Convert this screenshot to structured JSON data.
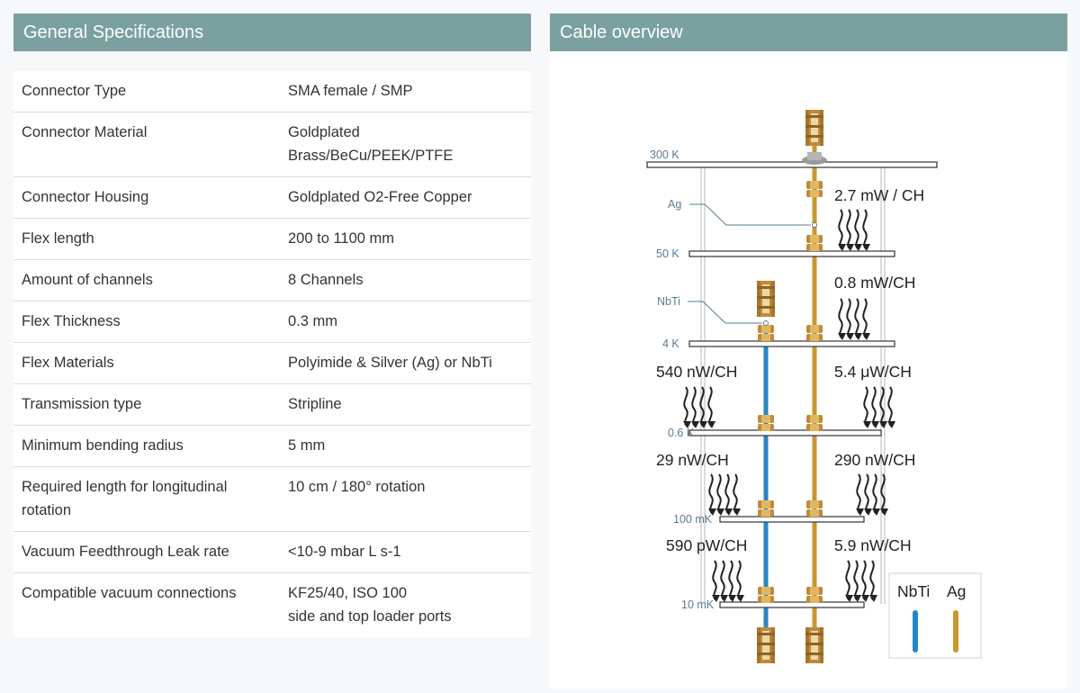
{
  "general": {
    "title": "General Specifications",
    "rows": [
      {
        "label": "Connector Type",
        "value": "SMA female / SMP"
      },
      {
        "label": "Connector Material",
        "value": "Goldplated\nBrass/BeCu/PEEK/PTFE"
      },
      {
        "label": "Connector Housing",
        "value": "Goldplated O2-Free Copper"
      },
      {
        "label": "Flex length",
        "value": "200 to 1100 mm"
      },
      {
        "label": "Amount of channels",
        "value": "8 Channels"
      },
      {
        "label": "Flex Thickness",
        "value": "0.3 mm"
      },
      {
        "label": "Flex Materials",
        "value": "Polyimide & Silver (Ag) or NbTi"
      },
      {
        "label": "Transmission type",
        "value": "Stripline"
      },
      {
        "label": "Minimum bending radius",
        "value": "5 mm"
      },
      {
        "label": "Required length for longitudinal\nrotation",
        "value": "10 cm / 180° rotation"
      },
      {
        "label": "Vacuum Feedthrough Leak rate",
        "value": "<10-9 mbar L s-1"
      },
      {
        "label": "Compatible vacuum connections",
        "value": "KF25/40, ISO 100\nside and top loader ports"
      }
    ]
  },
  "cable": {
    "title": "Cable overview",
    "stages": {
      "s300k": "300 K",
      "s50k": "50 K",
      "s4k": "4 K",
      "s06k": "0.6 K",
      "s100mk": "100 mK",
      "s10mk": "10 mK"
    },
    "material_labels": {
      "ag": "Ag",
      "nbti": "NbTi"
    },
    "heat_loads": {
      "ag_300_50": "2.7 mW / CH",
      "ag_50_4": "0.8 mW/CH",
      "nbti_4_06": "540 nW/CH",
      "ag_4_06": "5.4 μW/CH",
      "nbti_06_100": "29 nW/CH",
      "ag_06_100": "290 nW/CH",
      "nbti_100_10": "590 pW/CH",
      "ag_100_10": "5.9 nW/CH"
    },
    "legend": {
      "nbti": "NbTi",
      "ag": "Ag"
    },
    "colors": {
      "nbti": "#2588c8",
      "ag": "#c9972e",
      "header": "#7aa19f",
      "connector": "#c08a3a"
    }
  }
}
